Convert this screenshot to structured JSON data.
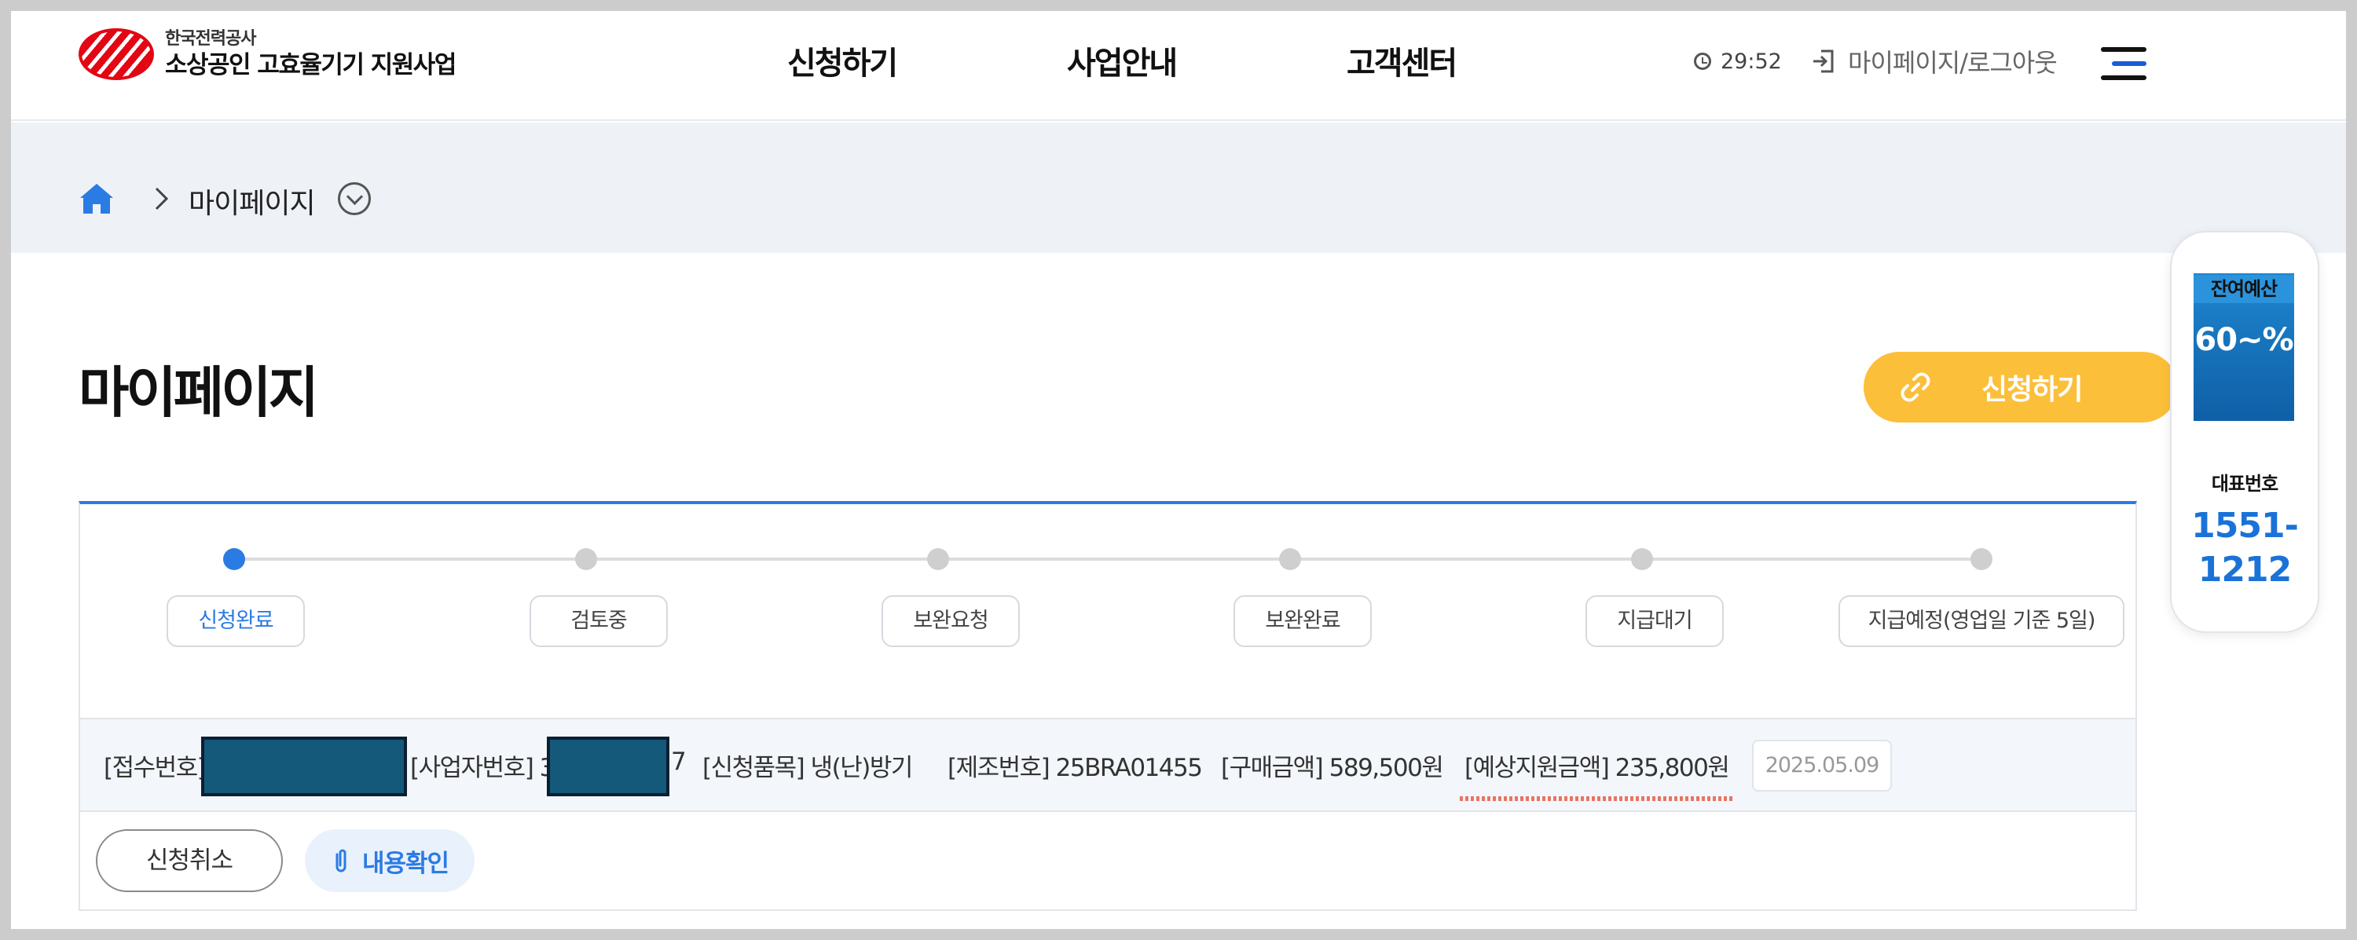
{
  "header": {
    "logo_small": "한국전력공사",
    "logo_big": "소상공인 고효율기기 지원사업",
    "nav": [
      "신청하기",
      "사업안내",
      "고객센터"
    ],
    "timer": "29:52",
    "mypage_logout": "마이페이지/로그아웃"
  },
  "breadcrumb": {
    "current": "마이페이지"
  },
  "page": {
    "title": "마이페이지",
    "apply_button": "신청하기"
  },
  "side_widget": {
    "budget_label": "잔여예산",
    "budget_value": "60~%",
    "rep_label": "대표번호",
    "rep_number": "1551-1212"
  },
  "application": {
    "steps": [
      {
        "label": "신청완료",
        "active": true
      },
      {
        "label": "검토중",
        "active": false
      },
      {
        "label": "보완요청",
        "active": false
      },
      {
        "label": "보완완료",
        "active": false
      },
      {
        "label": "지급대기",
        "active": false
      },
      {
        "label": "지급예정(영업일 기준 5일)",
        "active": false
      }
    ],
    "info": {
      "receipt_label": "[접수번호]",
      "business_label": "[사업자번호] 3",
      "business_tail": "7",
      "item": "[신청품목] 냉(난)방기",
      "serial": "[제조번호] 25BRA01455",
      "purchase": "[구매금액] 589,500원",
      "expected": "[예상지원금액] 235,800원",
      "date": "2025.05.09"
    },
    "cancel_button": "신청취소",
    "view_button": "내용확인"
  },
  "colors": {
    "accent_blue": "#2b7be4",
    "apply_yellow": "#fcbf3a",
    "brand_red": "#e30613",
    "budget_blue": "#1e86cf",
    "mask": "#14587a"
  }
}
